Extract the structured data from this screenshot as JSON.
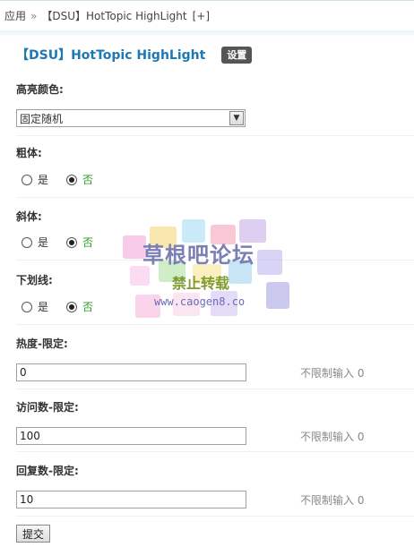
{
  "breadcrumb": {
    "root": "应用",
    "separator": "»",
    "current": "【DSU】HotTopic HighLight",
    "add": "[+]"
  },
  "header": {
    "title": "【DSU】HotTopic HighLight",
    "settings_label": "设置"
  },
  "form": {
    "color": {
      "label": "高亮颜色:",
      "value": "固定随机"
    },
    "bold": {
      "label": "粗体:",
      "yes": "是",
      "no": "否",
      "selected": "no"
    },
    "italic": {
      "label": "斜体:",
      "yes": "是",
      "no": "否",
      "selected": "no"
    },
    "underline": {
      "label": "下划线:",
      "yes": "是",
      "no": "否",
      "selected": "no"
    },
    "heat": {
      "label": "热度-限定:",
      "value": "0",
      "hint": "不限制输入 0"
    },
    "views": {
      "label": "访问数-限定:",
      "value": "100",
      "hint": "不限制输入 0"
    },
    "replies": {
      "label": "回复数-限定:",
      "value": "10",
      "hint": "不限制输入 0"
    },
    "submit_label": "提交"
  },
  "watermark": {
    "title": "草根吧论坛",
    "subtitle": "禁止转载",
    "url": "www.caogen8.co"
  }
}
